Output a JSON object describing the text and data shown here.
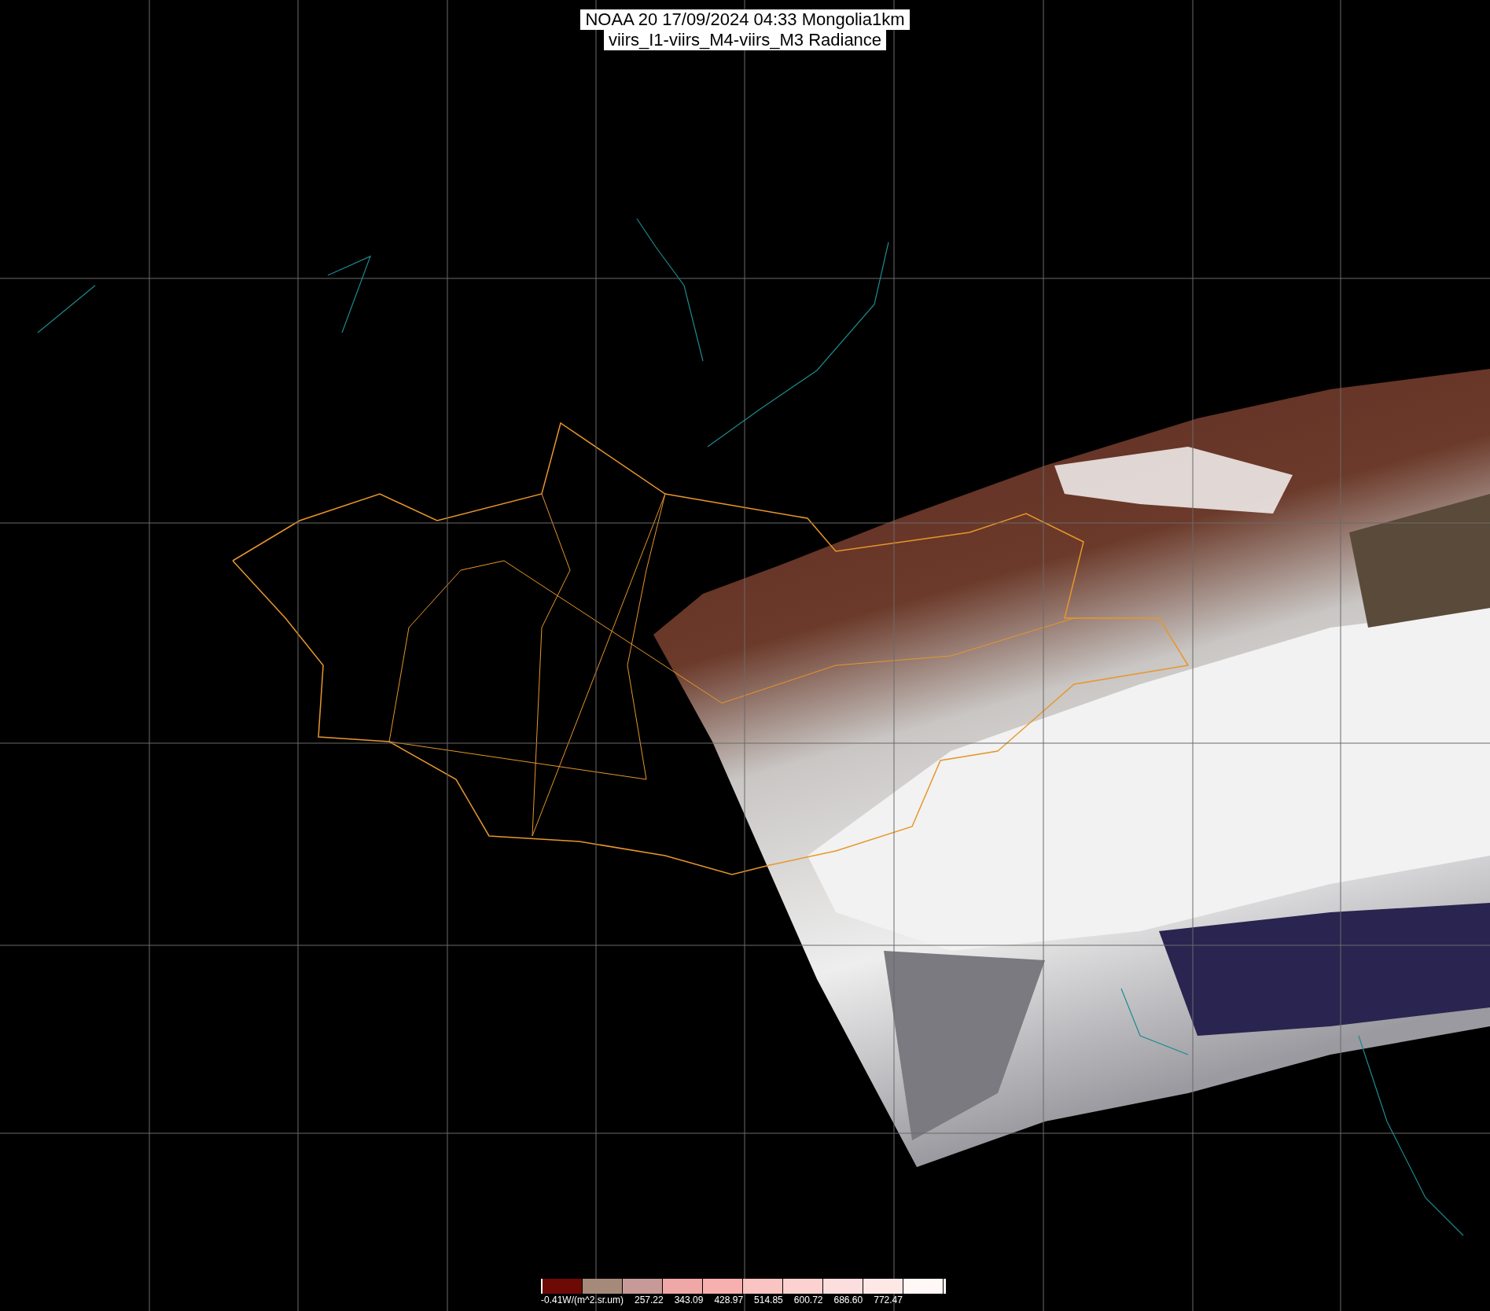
{
  "title": {
    "lines": [
      "NOAA 20 17/09/2024 04:33 Mongolia1km",
      "viirs_I1-viirs_M4-viirs_M3 Radiance"
    ]
  },
  "colorbar": {
    "segments": [
      {
        "color": "#6e0a05"
      },
      {
        "color": "#a58a7a"
      },
      {
        "color": "#c79a98"
      },
      {
        "color": "#f0a8a6"
      },
      {
        "color": "#f8b0ae"
      },
      {
        "color": "#fac4c2"
      },
      {
        "color": "#fbd2d0"
      },
      {
        "color": "#fcdede"
      },
      {
        "color": "#fde8e6"
      },
      {
        "color": "#fff8f6"
      }
    ],
    "labels": [
      "-0.41W/(m^2.sr.um)",
      "257.22",
      "343.09",
      "428.97",
      "514.85",
      "600.72",
      "686.60",
      "772.47"
    ]
  }
}
